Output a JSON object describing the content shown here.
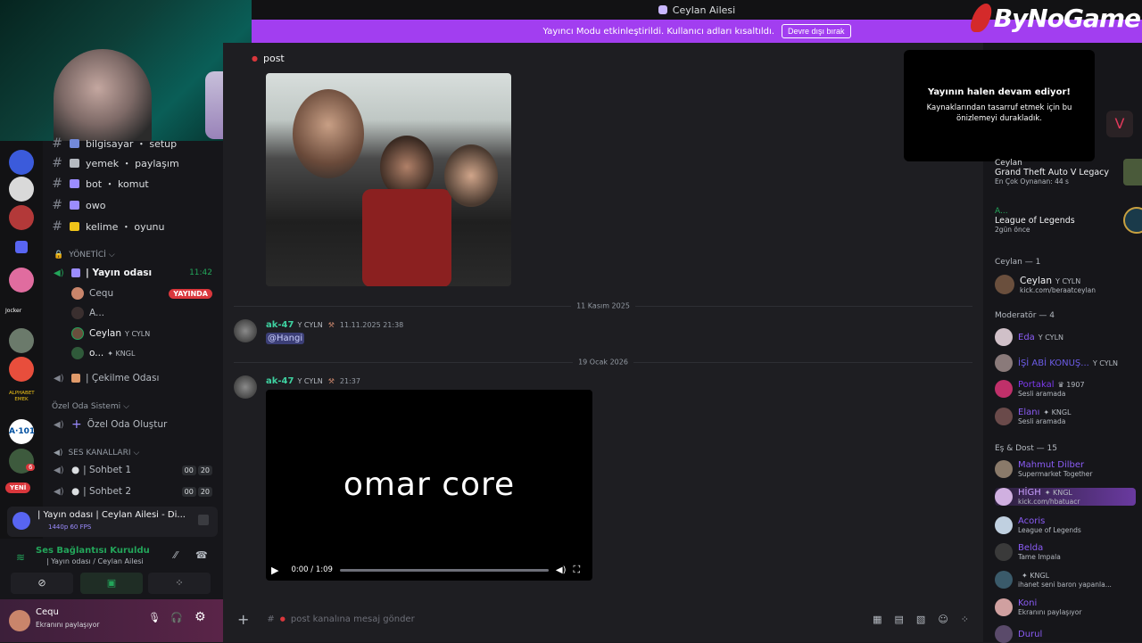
{
  "window": {
    "title": "Ceylan Ailesi",
    "logo": "ByNoGame"
  },
  "banner": {
    "text": "Yayıncı Modu etkinleştirildi. Kullanıcı adları kısaltıldı.",
    "button": "Devre dışı bırak"
  },
  "channel_header": {
    "name": "post"
  },
  "channels": [
    {
      "name": "bilgisayar ・ setup",
      "color": "#7289da"
    },
    {
      "name": "yemek ・ paylaşım",
      "color": "#b5bac1"
    },
    {
      "name": "bot ・ komut",
      "color": "#9b8cff"
    },
    {
      "name": "owo",
      "color": "#9b8cff"
    },
    {
      "name": "kelime ・ oyunu",
      "color": "#f0c419"
    }
  ],
  "category_admin": "YÖNETİCİ",
  "voice_main": {
    "name": "| Yayın odası",
    "time": "11:42"
  },
  "voice_users": [
    {
      "name": "Cequ",
      "badge": "YAYINDA"
    },
    {
      "name": "A...",
      "badge": ""
    },
    {
      "name": "Ceylan",
      "badge": "CYLN"
    },
    {
      "name": "o...",
      "badge": "KNGL"
    }
  ],
  "withdraw_room": "| Çekilme Odası",
  "private_room": {
    "category": "Özel Oda Sistemi",
    "create": "Özel Oda Oluştur"
  },
  "voice_category": "SES KANALLARI",
  "voice_channels": [
    {
      "name": "| Sohbet 1",
      "a": "00",
      "b": "20"
    },
    {
      "name": "| Sohbet 2",
      "a": "00",
      "b": "20"
    }
  ],
  "stream_panel": {
    "title": "| Yayın odası | Ceylan Ailesi - Di...",
    "quality": "1440p 60 FPS"
  },
  "connection": {
    "status": "Ses Bağlantısı Kuruldu",
    "location": "| Yayın odası / Ceylan Ailesi"
  },
  "user": {
    "name": "Cequ",
    "status": "Ekranını paylaşıyor"
  },
  "rail_badges": {
    "new": "YENİ",
    "count": "6",
    "jocker": "Jocker",
    "alphabet": "ALPHABET EMEK",
    "a101": "A·101"
  },
  "messages": [
    {
      "author": "ak-47",
      "tag": "CYLN",
      "time": "11.11.2025 21:38",
      "text": "@Hangi",
      "date_above": "11 Kasım 2025"
    },
    {
      "author": "ak-47",
      "tag": "CYLN",
      "time": "21:37",
      "text": "",
      "date_above": "19 Ocak 2026"
    }
  ],
  "video": {
    "overlay_text": "omar core",
    "time": "0:00 / 1:09",
    "progress": 0
  },
  "composer": {
    "placeholder": "post kanalına mesaj gönder"
  },
  "popup": {
    "title": "Yayının halen devam ediyor!",
    "body": "Kaynaklarından tasarruf etmek için bu önizlemeyi durakladık."
  },
  "activities": [
    {
      "name": "Ceylan",
      "game": "Grand Theft Auto V Legacy",
      "detail": "En Çok Oynanan: 44 s"
    },
    {
      "name": "A...",
      "game": "League of Legends",
      "detail": "2gün önce"
    }
  ],
  "member_groups": [
    {
      "label": "Ceylan — 1"
    },
    {
      "label": "Moderatör — 4"
    },
    {
      "label": "Eş & Dost — 15"
    }
  ],
  "owner": {
    "name": "Ceylan",
    "tag": "CYLN",
    "sub": "kick.com/beraatceylan"
  },
  "moderators": [
    {
      "name": "Eda",
      "tag": "CYLN",
      "sub": ""
    },
    {
      "name": "İŞİ ABİ KONUŞ...",
      "tag": "CYLN",
      "sub": ""
    },
    {
      "name": "Portakal",
      "tag": "1907",
      "sub": "Sesli aramada"
    },
    {
      "name": "Elanı",
      "tag": "KNGL",
      "sub": "Sesli aramada"
    }
  ],
  "friends": [
    {
      "name": "Mahmut Dilber",
      "tag": "",
      "sub": "Supermarket Together"
    },
    {
      "name": "HİGH",
      "tag": "KNGL",
      "sub": "kick.com/hbatuacr"
    },
    {
      "name": "Acoris",
      "tag": "",
      "sub": "League of Legends"
    },
    {
      "name": "Belda",
      "tag": "",
      "sub": "Tame Impala"
    },
    {
      "name": "",
      "tag": "KNGL",
      "sub": "ihanet seni baron yapanla..."
    },
    {
      "name": "Koni",
      "tag": "",
      "sub": "Ekranını paylaşıyor"
    },
    {
      "name": "Durul",
      "tag": "",
      "sub": ""
    }
  ]
}
